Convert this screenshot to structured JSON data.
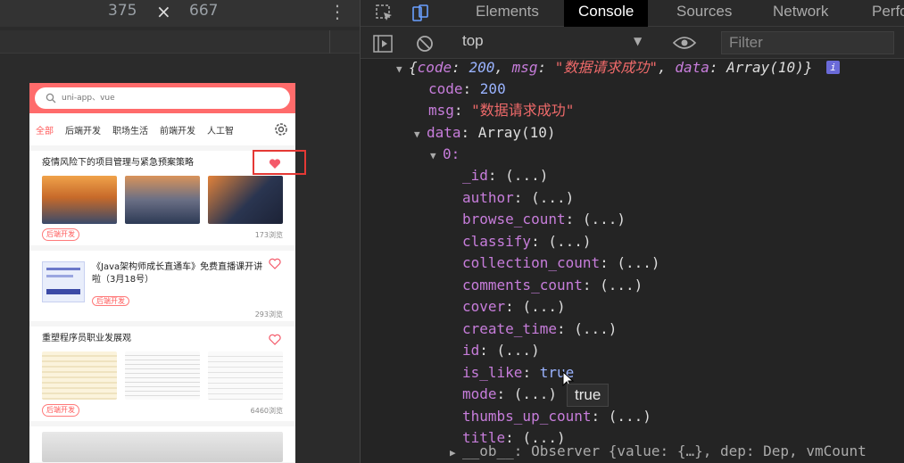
{
  "emulator": {
    "width": "375",
    "times": "×",
    "height": "667",
    "kebab": "⋮"
  },
  "app": {
    "search_placeholder": "uni-app、vue",
    "tabs": [
      "全部",
      "后端开发",
      "职场生活",
      "前端开发",
      "人工智"
    ],
    "cards": [
      {
        "title": "疫情风险下的项目管理与紧急预案策略",
        "badge": "后端开发",
        "views": "173浏览",
        "liked": true
      },
      {
        "title": "《Java架构师成长直通车》免费直播课开讲啦（3月18号）",
        "badge": "后端开发",
        "views": "293浏览",
        "liked": false
      },
      {
        "title": "重塑程序员职业发展观",
        "badge": "后端开发",
        "views": "6460浏览",
        "liked": false
      }
    ],
    "accent": "#ff6b6b"
  },
  "devtools": {
    "tabs": [
      "Elements",
      "Console",
      "Sources",
      "Network",
      "Perfo"
    ],
    "active_tab": "Console",
    "context": "top",
    "filter_placeholder": "Filter",
    "console": {
      "summary": {
        "open": "{",
        "code_key": "code",
        "code_val": "200",
        "msg_key": "msg",
        "msg_val": "\"数据请求成功\"",
        "data_key": "data",
        "data_val": "Array(10)",
        "close": "}",
        "badge": "i"
      },
      "code": {
        "key": "code",
        "value": "200"
      },
      "msg": {
        "key": "msg",
        "value": "\"数据请求成功\""
      },
      "data": {
        "key": "data",
        "value": "Array(10)"
      },
      "item_index": "0:",
      "fields": [
        "_id",
        "author",
        "browse_count",
        "classify",
        "collection_count",
        "comments_count",
        "cover",
        "create_time",
        "id",
        "is_like",
        "mode",
        "thumbs_up_count",
        "title"
      ],
      "lazy": "(...)",
      "is_like_value": "true",
      "ob_line": "__ob__: Observer {value: {…}, dep: Dep, vmCount",
      "tooltip": "true"
    }
  }
}
